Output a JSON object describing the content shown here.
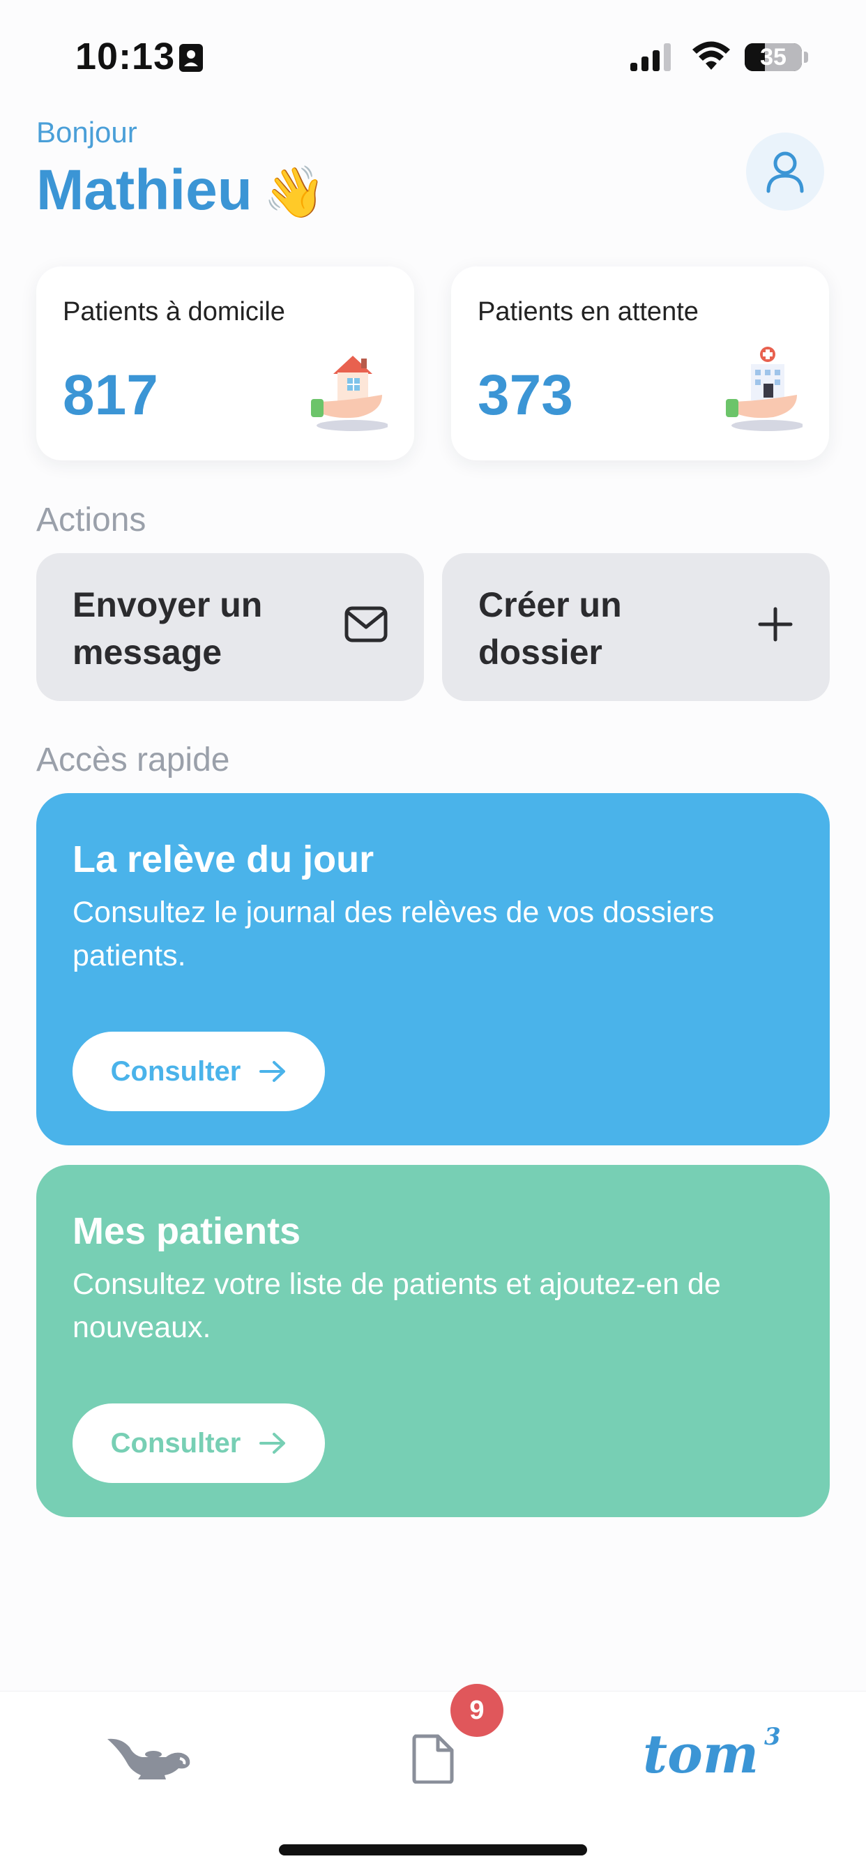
{
  "status_bar": {
    "time": "10:13",
    "battery": "35",
    "icons": [
      "id-card-icon",
      "signal-icon",
      "wifi-icon",
      "battery-icon"
    ]
  },
  "header": {
    "greeting": "Bonjour",
    "name": "Mathieu",
    "emoji": "👋",
    "avatar_icon": "user-icon"
  },
  "stats": {
    "home_patients": {
      "label": "Patients à domicile",
      "value": "817",
      "icon": "house-in-hand-icon"
    },
    "waiting_patients": {
      "label": "Patients en attente",
      "value": "373",
      "icon": "hospital-in-hand-icon"
    }
  },
  "actions": {
    "title": "Actions",
    "send_message": {
      "label": "Envoyer un message",
      "icon": "envelope-icon"
    },
    "create_file": {
      "label": "Créer un dossier",
      "icon": "plus-icon"
    }
  },
  "quick_access": {
    "title": "Accès rapide",
    "cards": [
      {
        "title": "La relève du jour",
        "description": "Consultez le journal des relèves de vos dossiers patients.",
        "button": "Consulter",
        "color": "#4ab3ea"
      },
      {
        "title": "Mes patients",
        "description": "Consultez votre liste de patients et ajoutez-en de nouveaux.",
        "button": "Consulter",
        "color": "#77cfb4"
      }
    ]
  },
  "tabbar": {
    "tabs": [
      "genie-lamp-icon",
      "document-icon",
      "tom3-logo"
    ],
    "badge": "9",
    "logo_text": "tom"
  },
  "colors": {
    "accent_blue": "#3b95d5",
    "card_blue": "#4ab3ea",
    "card_green": "#77cfb4",
    "badge_red": "#e0575b"
  }
}
